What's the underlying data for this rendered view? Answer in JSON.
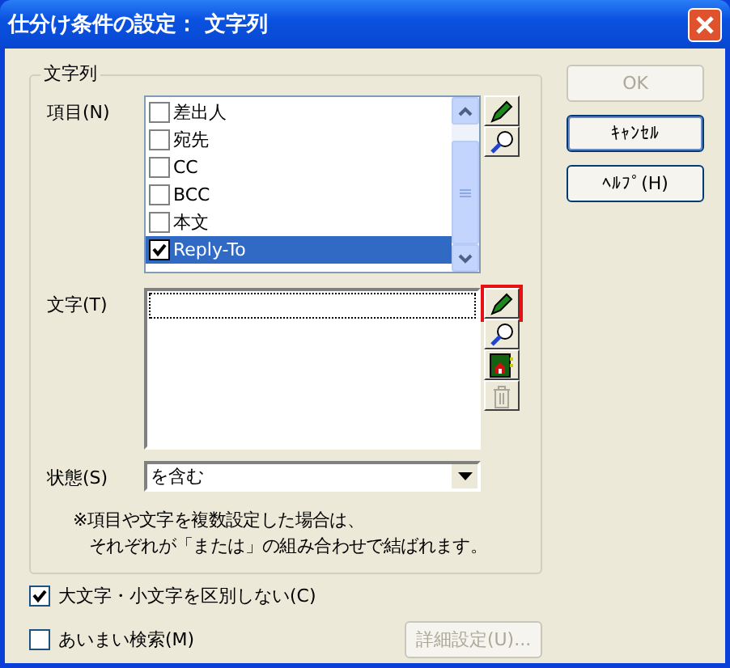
{
  "window": {
    "title": "仕分け条件の設定： 文字列"
  },
  "group": {
    "title": "文字列",
    "items_field": {
      "label": "項目(N)",
      "items": [
        {
          "text": "差出人",
          "checked": false,
          "selected": false
        },
        {
          "text": "宛先",
          "checked": false,
          "selected": false
        },
        {
          "text": "CC",
          "checked": false,
          "selected": false
        },
        {
          "text": "BCC",
          "checked": false,
          "selected": false
        },
        {
          "text": "本文",
          "checked": false,
          "selected": false
        },
        {
          "text": "Reply-To",
          "checked": true,
          "selected": true
        }
      ],
      "tools": [
        {
          "kind": "edit"
        },
        {
          "kind": "search"
        }
      ]
    },
    "text_field": {
      "label": "文字(T)",
      "tools": [
        {
          "kind": "edit",
          "disabled": false,
          "focused": true
        },
        {
          "kind": "search",
          "disabled": false,
          "focused": false
        },
        {
          "kind": "import",
          "disabled": false,
          "focused": false
        },
        {
          "kind": "delete",
          "disabled": true,
          "focused": false
        }
      ]
    },
    "state_field": {
      "label": "状態(S)",
      "value": "を含む"
    },
    "note": [
      "※項目や文字を複数設定した場合は、",
      "それぞれが「または」の組み合わせで結ばれます。"
    ]
  },
  "options": [
    {
      "label": "大文字・小文字を区別しない(C)",
      "checked": true
    },
    {
      "label": "あいまい検索(M)",
      "checked": false
    }
  ],
  "detail_button": {
    "label": "詳細設定(U)...",
    "disabled": true
  },
  "buttons": [
    {
      "label": "OK",
      "disabled": true,
      "default": false
    },
    {
      "label": "ｷｬﾝｾﾙ",
      "disabled": false,
      "default": true
    },
    {
      "label": "ﾍﾙﾌﾟ(H)",
      "disabled": false,
      "default": false
    }
  ]
}
